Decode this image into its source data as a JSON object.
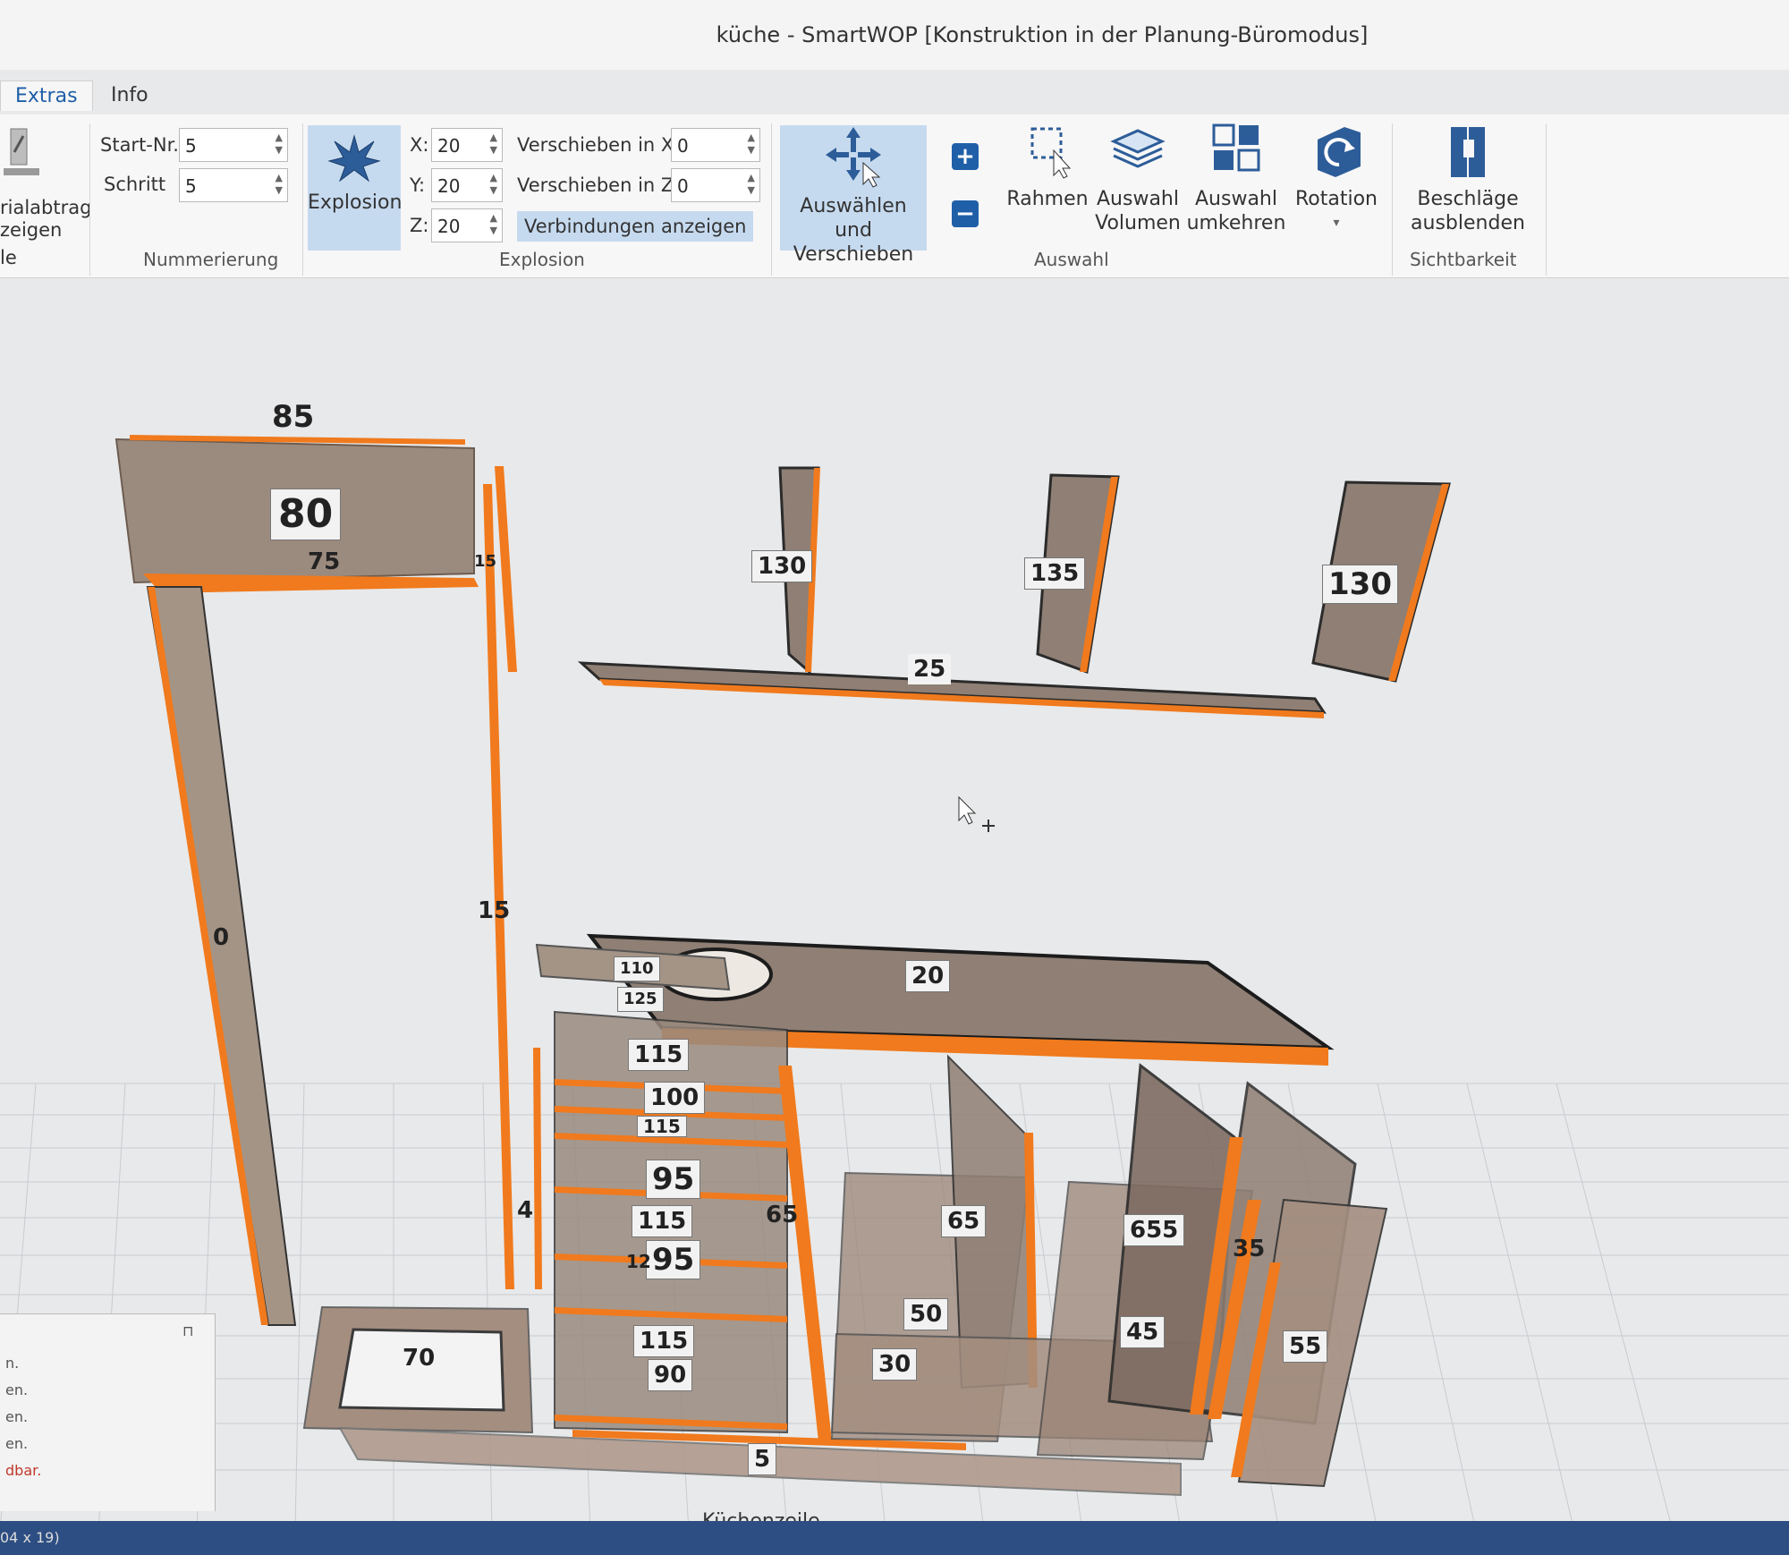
{
  "window": {
    "title": "küche - SmartWOP [Konstruktion in der Planung-Büromodus]"
  },
  "tabs": [
    {
      "label": "Extras",
      "active": true
    },
    {
      "label": "Info",
      "active": false
    }
  ],
  "ribbon": {
    "left_partial": {
      "line1": "rialabtrag",
      "line2": "zeigen",
      "line3": "le"
    },
    "numbering": {
      "group_label": "Nummerierung",
      "start_label": "Start-Nr.",
      "start_value": "5",
      "step_label": "Schritt",
      "step_value": "5"
    },
    "explosion": {
      "group_label": "Explosion",
      "button_label": "Explosion",
      "x_label": "X:",
      "x_value": "20",
      "y_label": "Y:",
      "y_value": "20",
      "z_label": "Z:",
      "z_value": "20",
      "move_x_label": "Verschieben in X:",
      "move_x_value": "0",
      "move_z_label": "Verschieben in Z:",
      "move_z_value": "0",
      "show_connections_label": "Verbindungen anzeigen"
    },
    "selection": {
      "group_label": "Auswahl",
      "select_move_line1": "Auswählen und",
      "select_move_line2": "Verschieben",
      "add_symbol": "+",
      "remove_symbol": "−",
      "frame_label": "Rahmen",
      "volume_line1": "Auswahl",
      "volume_line2": "Volumen",
      "invert_line1": "Auswahl",
      "invert_line2": "umkehren",
      "rotation_label": "Rotation",
      "rotation_arrow": "▾"
    },
    "visibility": {
      "group_label": "Sichtbarkeit",
      "hide_fittings_line1": "Beschläge",
      "hide_fittings_line2": "ausblenden"
    }
  },
  "viewport": {
    "labels": {
      "top_width": "85",
      "top_panel": "80",
      "top_inner": "75",
      "top_edge": "15",
      "side_left": "0",
      "tall_strip": "15",
      "upper_side1": "130",
      "upper_side2": "135",
      "upper_side3": "130",
      "upper_bottom": "25",
      "worktop": "20",
      "wt_small1": "110",
      "wt_small2": "125",
      "drawer1_top": "115",
      "drawer1_mid": "100",
      "drawer1_low": "115",
      "drawer2_front": "95",
      "drawer3_top": "115",
      "drawer3_front": "95",
      "drawer3_sub": "12",
      "drawer4_top": "115",
      "drawer4_front": "90",
      "left_small": "4",
      "side_small": "65",
      "plinth_frame": "70",
      "plinth_bottom": "5",
      "cab2_side": "65",
      "cab2_back": "50",
      "cab2_bottom": "30",
      "cab3_side": "655",
      "cab3_back": "45",
      "cab3_shelf": "35",
      "cab4_front": "55"
    },
    "bottom_label": "Küchenzeile"
  },
  "side_panel": {
    "pin": "⊓",
    "items": [
      "n.",
      "en.",
      "en.",
      "en.",
      "dbar."
    ]
  },
  "status": {
    "text": "04 x 19)"
  },
  "colors": {
    "edge": "#f07a1d",
    "panel": "#8f7f74",
    "accent": "#1f5fa8",
    "highlight": "#c6daef"
  }
}
